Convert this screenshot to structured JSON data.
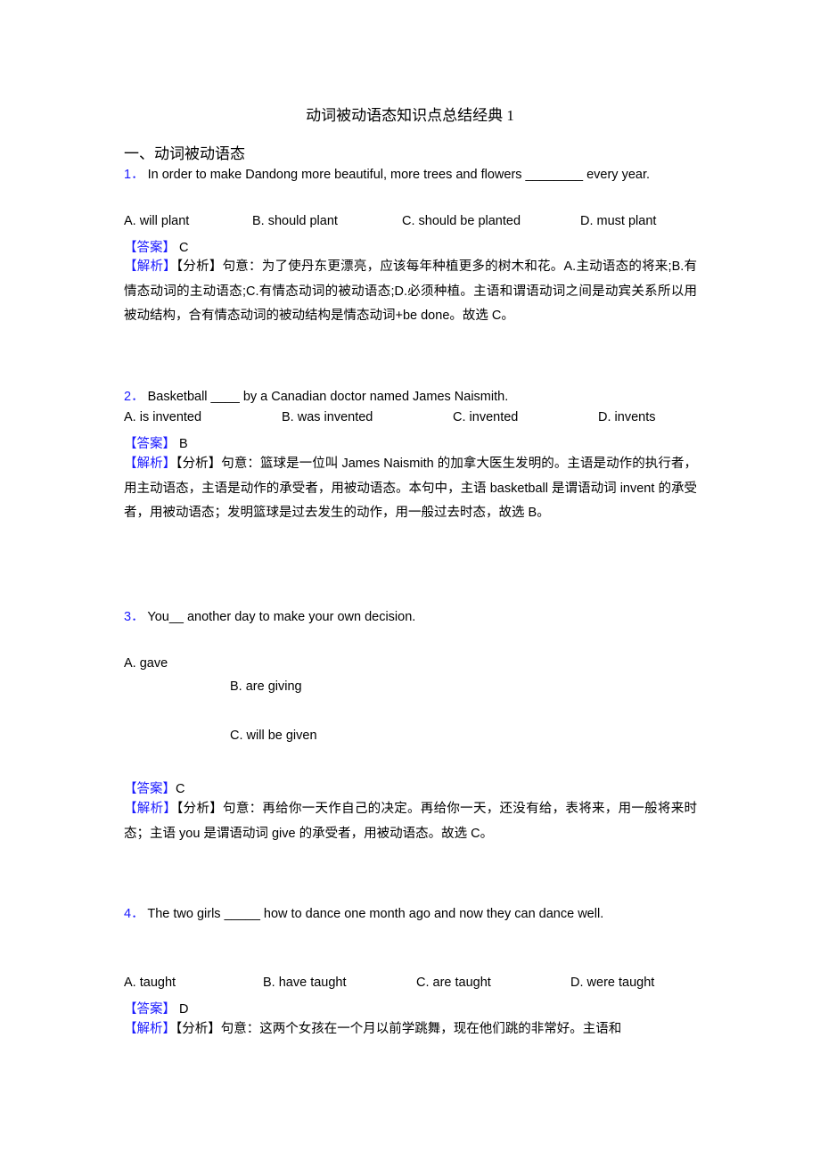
{
  "document": {
    "title": "动词被动语态知识点总结经典 1",
    "section_heading": "一、动词被动语态",
    "answer_tag": "【答案】",
    "analysis_tag": "【解析】",
    "questions": [
      {
        "number": "1．",
        "stem": "In order to make Dandong more beautiful, more trees and flowers ________ every year.",
        "options": [
          "A. will plant",
          "B. should plant",
          "C. should be planted",
          "D. must plant"
        ],
        "answer": "C",
        "analysis": "【分析】句意：为了使丹东更漂亮，应该每年种植更多的树木和花。A.主动语态的将来;B.有情态动词的主动语态;C.有情态动词的被动语态;D.必须种植。主语和谓语动词之间是动宾关系所以用被动结构，合有情态动词的被动结构是情态动词+be done。故选 C。"
      },
      {
        "number": "2．",
        "stem": "Basketball ____ by a Canadian doctor named James Naismith.",
        "options": [
          "A. is invented",
          "B. was invented",
          "C. invented",
          "D. invents"
        ],
        "answer": "B",
        "analysis": "【分析】句意：篮球是一位叫 James Naismith 的加拿大医生发明的。主语是动作的执行者，用主动语态，主语是动作的承受者，用被动语态。本句中，主语 basketball 是谓语动词 invent 的承受者，用被动语态；发明篮球是过去发生的动作，用一般过去时态，故选 B。"
      },
      {
        "number": "3．",
        "stem": "You__ another day to make your own decision.",
        "options": [
          "A. gave",
          "B. are giving",
          "C. will be given"
        ],
        "answer": "C",
        "analysis": "【分析】句意：再给你一天作自己的决定。再给你一天，还没有给，表将来，用一般将来时态；主语 you 是谓语动词 give 的承受者，用被动语态。故选 C。"
      },
      {
        "number": "4．",
        "stem": "The two girls _____ how to dance one month ago and now they can dance well.",
        "options": [
          "A. taught",
          "B. have taught",
          "C. are taught",
          "D. were taught"
        ],
        "answer": "D",
        "analysis": "【分析】句意：这两个女孩在一个月以前学跳舞，现在他们跳的非常好。主语和"
      }
    ]
  }
}
